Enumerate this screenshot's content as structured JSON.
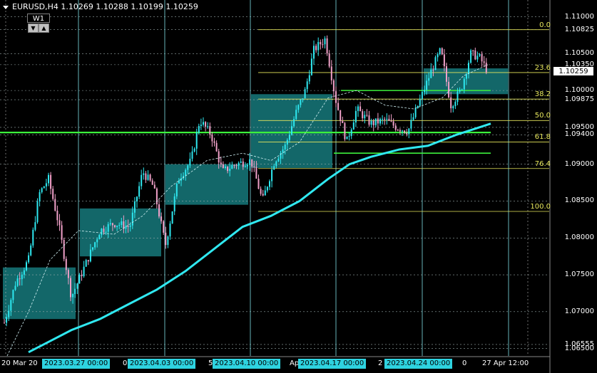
{
  "header": {
    "symbol_info": "EURUSD,H4  1.10269 1.10288 1.10199 1.10259",
    "timeframe_badge": "W1",
    "up_glyph": "▲",
    "down_glyph": "▼"
  },
  "price_axis": {
    "labels": [
      {
        "text": "1.11000",
        "value": 1.11
      },
      {
        "text": "1.10825",
        "value": 1.10825
      },
      {
        "text": "1.10500",
        "value": 1.105
      },
      {
        "text": "1.10350",
        "value": 1.1035
      },
      {
        "text": "1.10000",
        "value": 1.1
      },
      {
        "text": "1.09875",
        "value": 1.09875
      },
      {
        "text": "1.09500",
        "value": 1.095
      },
      {
        "text": "1.09400",
        "value": 1.094
      },
      {
        "text": "1.09000",
        "value": 1.09
      },
      {
        "text": "1.08500",
        "value": 1.085
      },
      {
        "text": "1.08000",
        "value": 1.08
      },
      {
        "text": "1.07500",
        "value": 1.075
      },
      {
        "text": "1.07000",
        "value": 1.07
      },
      {
        "text": "1.06555",
        "value": 1.06555
      },
      {
        "text": "1.06500",
        "value": 1.065
      }
    ],
    "current_price": "1.10259",
    "range": [
      1.064,
      1.1115
    ]
  },
  "fibonacci": {
    "high": 1.10825,
    "low": 1.0836,
    "levels": [
      {
        "label": "0.0",
        "ratio": 0.0
      },
      {
        "label": "23.6",
        "ratio": 0.236
      },
      {
        "label": "38.2",
        "ratio": 0.382
      },
      {
        "label": "50.0",
        "ratio": 0.5
      },
      {
        "label": "61.8",
        "ratio": 0.618
      },
      {
        "label": "76.4",
        "ratio": 0.764
      },
      {
        "label": "100.0",
        "ratio": 1.0
      }
    ]
  },
  "time_axis": {
    "plain_labels": [
      "20 Mar 20",
      "0",
      "5",
      "Apr",
      "2",
      "0",
      "27 Apr 12:00"
    ],
    "highlighted_labels": [
      "2023.03.27 00:00",
      "2023.04.03 00:00",
      "2023.04.10 00:00",
      "2023.04.17 00:00",
      "2023.04.24 00:00"
    ]
  },
  "colors": {
    "background": "#000000",
    "bull_candle": "#2ee8f0",
    "bear_candle": "#f0a0c8",
    "moving_average": "#30e8f0",
    "support_line": "#3cf03c",
    "fib_line": "#e6e65c",
    "zone_fill": "#1a8a8c",
    "grid_vertical": "#80e0e8"
  }
}
